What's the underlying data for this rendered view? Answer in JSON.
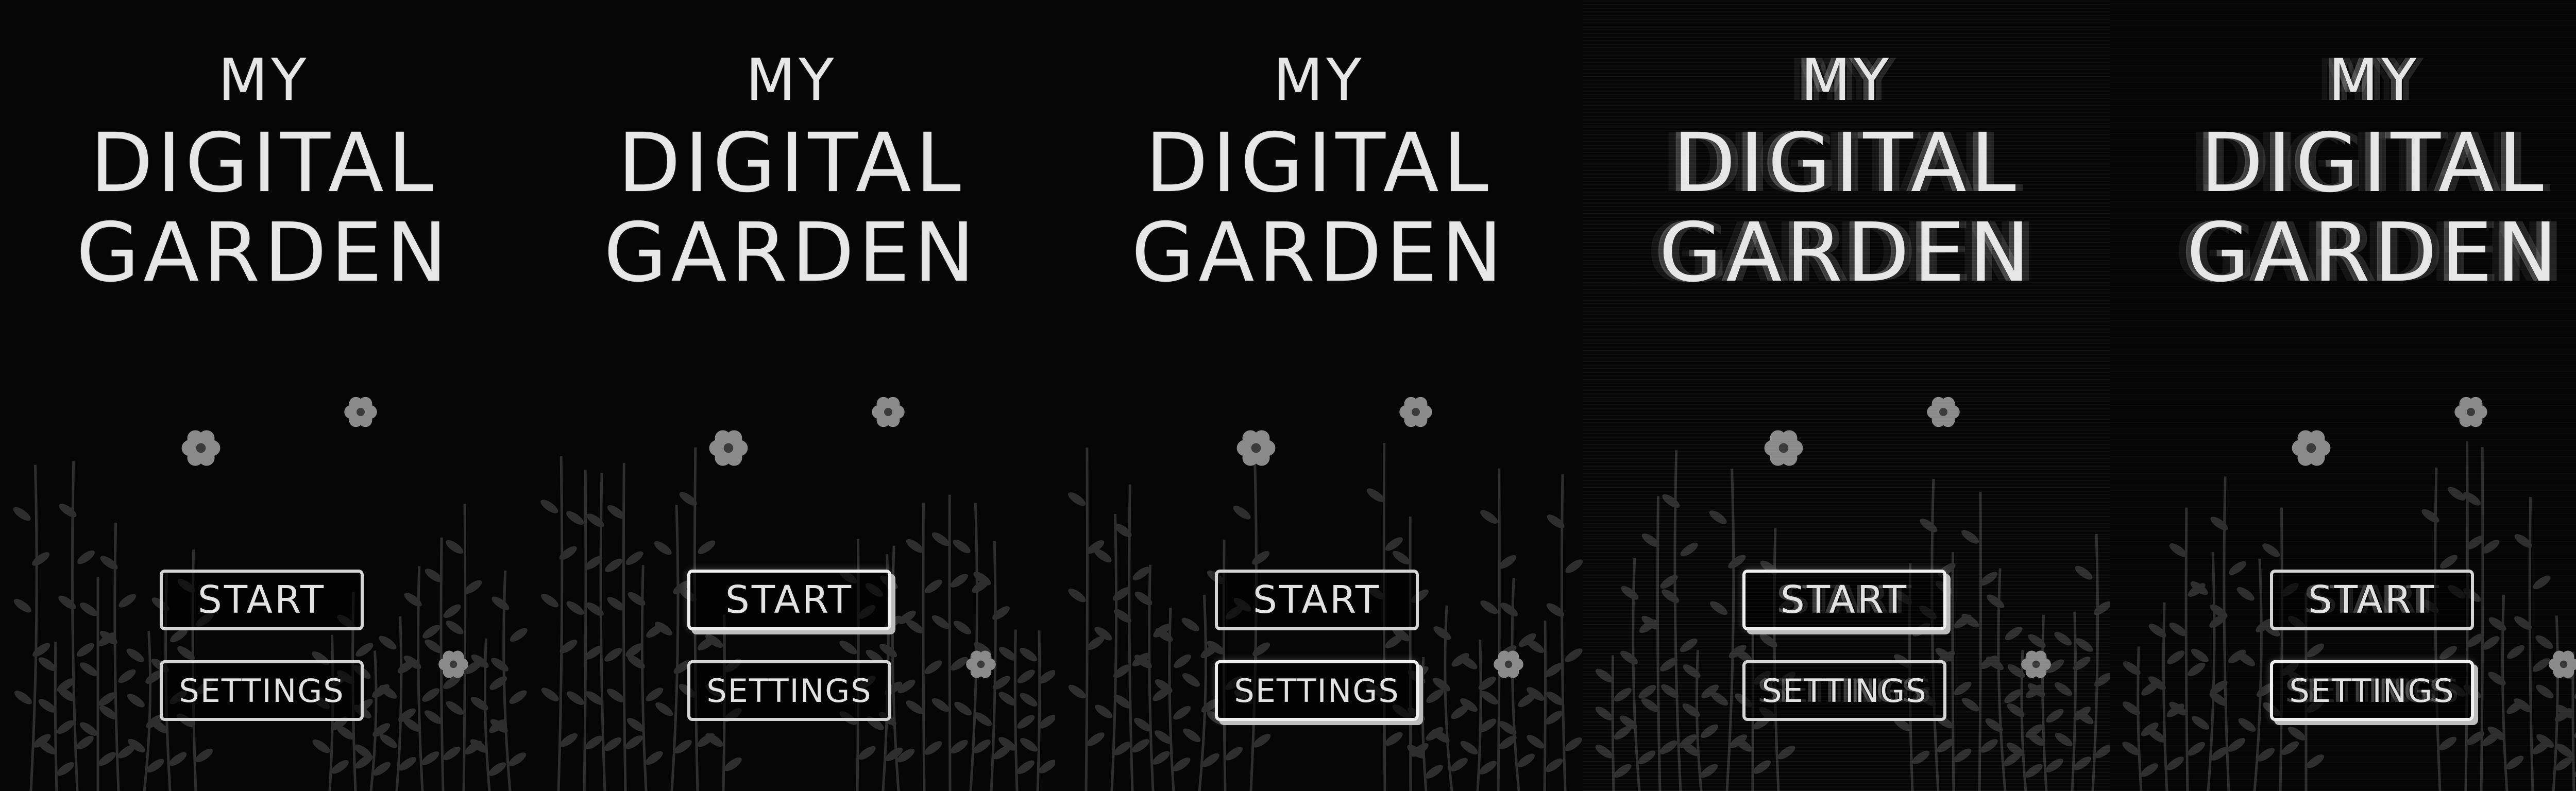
{
  "game": {
    "title_line1": "MY",
    "title_line2": "DIGITAL",
    "title_line3": "GARDEN"
  },
  "menu": {
    "start_label": "START",
    "settings_label": "SETTINGS"
  },
  "frames": [
    {
      "selected": "none",
      "effect": "none"
    },
    {
      "selected": "start",
      "effect": "none"
    },
    {
      "selected": "settings",
      "effect": "none"
    },
    {
      "selected": "start",
      "effect": "glitch"
    },
    {
      "selected": "settings",
      "effect": "glitch-light"
    }
  ],
  "colors": {
    "background": "#050505",
    "text": "#e6e6e6",
    "button_border": "#d4d4d4",
    "plant": "#2e2e2e",
    "flower": "#8a8a8a"
  },
  "icons": [
    "flower-icon",
    "plant-icon"
  ]
}
